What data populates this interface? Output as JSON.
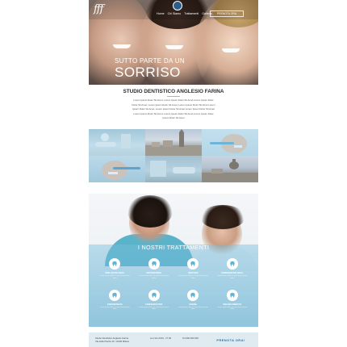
{
  "header": {
    "logo": "fff",
    "nav": [
      "Home",
      "Chi Siamo",
      "Trattamenti",
      "Galleria",
      "Contatti"
    ],
    "cta": "PRENOTA ORA"
  },
  "hero": {
    "small_text": "SUTTO PARTE DA UN",
    "big_text": "SORRISO"
  },
  "intro": {
    "title": "STUDIO DENTISTICO ANGLESIO FARINA",
    "paragraphs": [
      "Lorem Ipsum Dolor Sit Amet, Lorem Ipsum Dolor Sit Amet Lorem Ipsum Dolor",
      "Dolor Sit Amet, Lorem Ipsum Dolor Sit Amet, Lorem Ipsum Dolor Sit Amet Lorem",
      "Ipsum Dolor Sit Amet, Lorem Ipsum Dolor Sit Amet Lorem Ipsum Dolor Sit Amet",
      "Lorem Ipsum Dolor Sit Amet, Lorem Ipsum Dolor Sit Amet Lorem Ipsum Dolor",
      "Ipsum Dolor Sit Amet"
    ]
  },
  "treatments": {
    "title": "I NOSTRI TRATTAMENTI",
    "items": [
      {
        "label": "IMPLANTOLOGIA",
        "desc": "Lorem ipsum dolor sit amet lorem ipsum dolor"
      },
      {
        "label": "ORTODONZIA",
        "desc": "Lorem ipsum dolor sit amet lorem ipsum dolor"
      },
      {
        "label": "PROTESI",
        "desc": "Lorem ipsum dolor sit amet lorem ipsum dolor"
      },
      {
        "label": "PARODONTOLOGIA",
        "desc": "Lorem ipsum dolor sit amet lorem ipsum dolor"
      },
      {
        "label": "ENDODONZIA",
        "desc": "Lorem ipsum dolor sit amet lorem ipsum dolor"
      },
      {
        "label": "CONSERVATIVA",
        "desc": "Lorem ipsum dolor sit amet lorem ipsum dolor"
      },
      {
        "label": "IGIENE",
        "desc": "Lorem ipsum dolor sit amet lorem ipsum dolor"
      },
      {
        "label": "SBIANCAMENTO",
        "desc": "Lorem ipsum dolor sit amet lorem ipsum dolor"
      }
    ]
  },
  "footer": {
    "name": "Studio Dentistico Anglesio Farina",
    "address": "Via della Piazza 16, 10100 Milano",
    "hours": "Lun-Ven 8.00 - 17.00",
    "phone": "Tel 000 000 000",
    "cta": "PRENOTA ORA!"
  },
  "colors": {
    "accent": "#5fb3d3",
    "footer_bg": "#dfeaf1",
    "cta_text": "#2a78a8"
  }
}
